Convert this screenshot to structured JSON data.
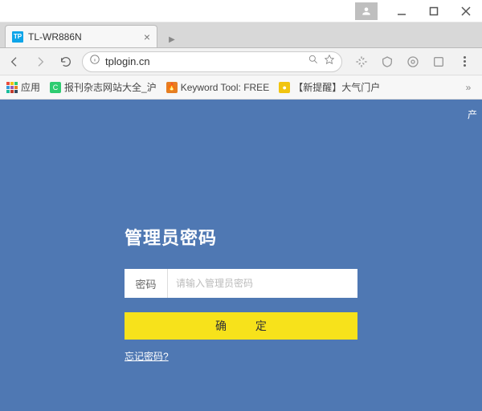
{
  "window": {
    "user_badge": "user"
  },
  "tab": {
    "favicon_text": "TP",
    "title": "TL-WR886N"
  },
  "address": {
    "url": "tplogin.cn"
  },
  "bookmarks": {
    "apps_label": "应用",
    "items": [
      {
        "label": "报刊杂志网站大全_沪"
      },
      {
        "label": "Keyword Tool: FREE"
      },
      {
        "label": "【新提醒】大气门户"
      }
    ]
  },
  "page": {
    "corner": "产",
    "heading": "管理员密码",
    "password_label": "密码",
    "password_placeholder": "请输入管理员密码",
    "submit_label": "确 定",
    "forgot_label": "忘记密码?"
  },
  "colors": {
    "page_bg": "#4f78b3",
    "accent": "#f7e21b"
  }
}
